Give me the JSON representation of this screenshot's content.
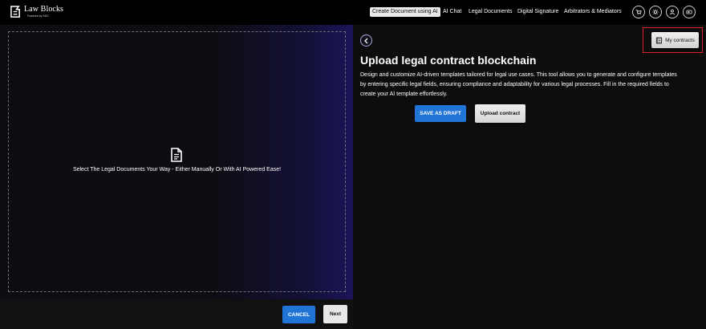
{
  "header": {
    "logo_name": "Law Blocks",
    "logo_sub": "Powered by XDC",
    "nav": [
      {
        "label": "Create Document using AI",
        "active": true
      },
      {
        "label": "AI Chat",
        "active": false
      },
      {
        "label": "Legal Documents",
        "active": false
      },
      {
        "label": "Digital Signature",
        "active": false
      },
      {
        "label": "Arbitrators & Mediators",
        "active": false
      }
    ],
    "icons": [
      "cart-icon",
      "sun-icon",
      "user-icon",
      "logout-icon"
    ]
  },
  "left": {
    "drop_text": "Select The Legal Documents Your Way - Either Manually Or With AI Powered Ease!",
    "cancel_label": "CANCEL",
    "next_label": "Next"
  },
  "right": {
    "my_contracts_label": "My contracts",
    "title": "Upload legal contract blockchain",
    "description": "Design and customize AI-driven templates tailored for legal use cases. This tool allows you to generate and configure templates by entering specific legal fields, ensuring compliance and adaptability for various legal processes. Fill in the required fields to create your AI template effortlessly.",
    "save_draft_label": "SAVE AS DRAFT",
    "upload_label": "Upload contract"
  },
  "colors": {
    "accent_blue": "#1f74d6",
    "highlight_red": "#d8232a"
  }
}
